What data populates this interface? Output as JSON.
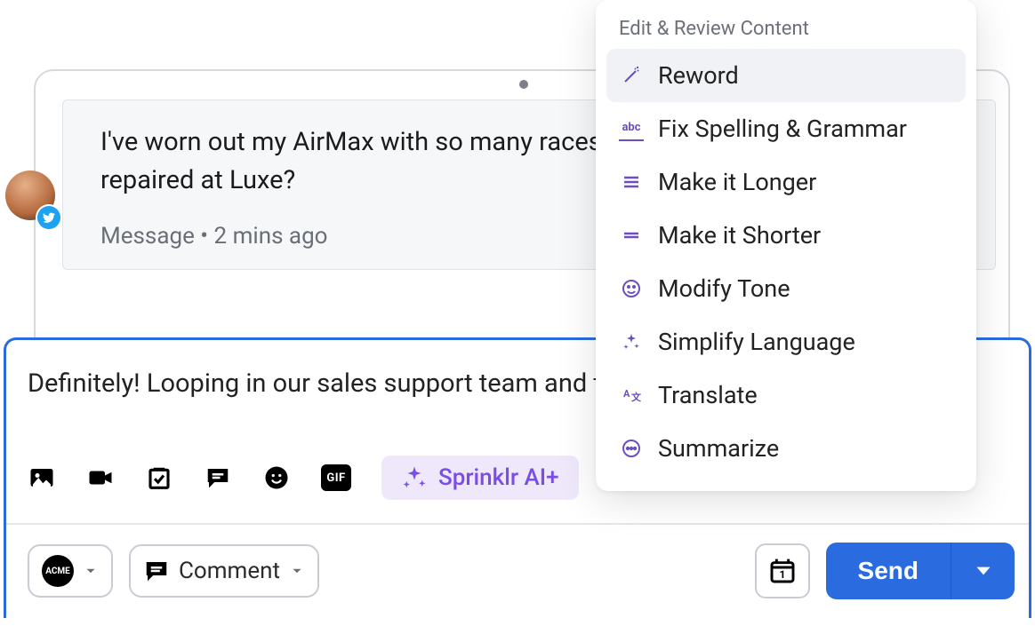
{
  "customer_message": {
    "text": "I've worn out my AirMax with so many races this year. Can I get them repaired at Luxe?",
    "meta": "Message • 2 mins ago"
  },
  "avatar_badge": "twitter",
  "reply_draft": "Definitely! Looping in our sales support team and they will help you with this.",
  "toolbar": {
    "gif_label": "GIF",
    "ai_label": "Sprinklr AI+"
  },
  "bottom_bar": {
    "brand": "ACME",
    "comment_label": "Comment",
    "calendar_day": "1",
    "send_label": "Send"
  },
  "menu": {
    "header": "Edit & Review Content",
    "items": [
      {
        "icon": "wand",
        "label": "Reword",
        "selected": true
      },
      {
        "icon": "abc",
        "label": "Fix Spelling & Grammar"
      },
      {
        "icon": "lines",
        "label": "Make it Longer"
      },
      {
        "icon": "lines2",
        "label": "Make it Shorter"
      },
      {
        "icon": "face",
        "label": "Modify Tone"
      },
      {
        "icon": "sparkles",
        "label": "Simplify Language"
      },
      {
        "icon": "translate",
        "label": "Translate"
      },
      {
        "icon": "summarize",
        "label": "Summarize"
      }
    ]
  }
}
